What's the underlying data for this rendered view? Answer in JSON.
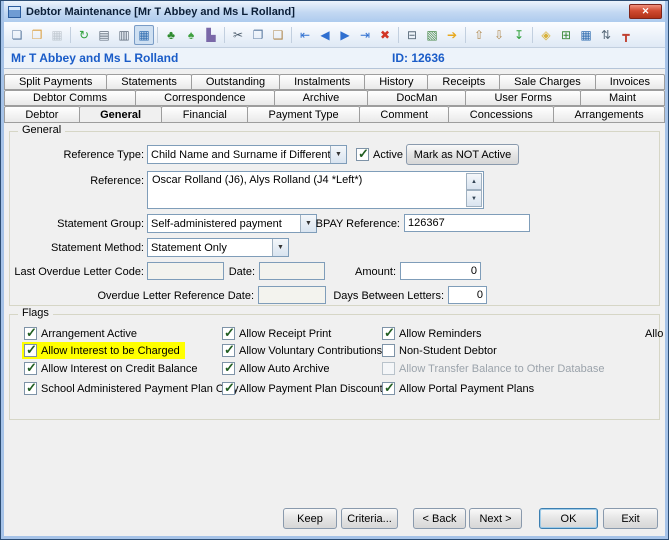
{
  "window": {
    "title": "Debtor Maintenance  [Mr T Abbey and Ms L Rolland]"
  },
  "toolbar": {
    "icons": [
      {
        "name": "new-document",
        "glyph": "❏"
      },
      {
        "name": "open-folder",
        "glyph": "❒"
      },
      {
        "name": "save",
        "glyph": "▦"
      },
      {
        "name": "refresh",
        "glyph": "↻"
      },
      {
        "name": "print",
        "glyph": "▤"
      },
      {
        "name": "print-preview",
        "glyph": "▥"
      },
      {
        "name": "data-grid",
        "glyph": "▦"
      },
      {
        "name": "tree-view",
        "glyph": "♣"
      },
      {
        "name": "palm-tree",
        "glyph": "♠"
      },
      {
        "name": "chart",
        "glyph": "▙"
      },
      {
        "name": "cut",
        "glyph": "✂"
      },
      {
        "name": "copy",
        "glyph": "❐"
      },
      {
        "name": "paste",
        "glyph": "❑"
      },
      {
        "name": "nav-first",
        "glyph": "⇤"
      },
      {
        "name": "nav-prev",
        "glyph": "◀"
      },
      {
        "name": "nav-next",
        "glyph": "▶"
      },
      {
        "name": "nav-last",
        "glyph": "⇥"
      },
      {
        "name": "delete",
        "glyph": "✖"
      },
      {
        "name": "remove-item",
        "glyph": "⊟"
      },
      {
        "name": "ledger",
        "glyph": "▧"
      },
      {
        "name": "forward",
        "glyph": "➔"
      },
      {
        "name": "export",
        "glyph": "⇧"
      },
      {
        "name": "import",
        "glyph": "⇩"
      },
      {
        "name": "download",
        "glyph": "↧"
      },
      {
        "name": "tag",
        "glyph": "◈"
      },
      {
        "name": "target",
        "glyph": "⊞"
      },
      {
        "name": "window-grid",
        "glyph": "▦"
      },
      {
        "name": "sort",
        "glyph": "⇅"
      },
      {
        "name": "pin",
        "glyph": "┳"
      }
    ]
  },
  "header": {
    "debtor_name": "Mr T Abbey and Ms L Rolland",
    "debtor_id": "ID: 12636"
  },
  "tabs": {
    "row1": [
      "Split Payments",
      "Statements",
      "Outstanding",
      "Instalments",
      "History",
      "Receipts",
      "Sale Charges",
      "Invoices"
    ],
    "row2": [
      "Debtor Comms",
      "Correspondence",
      "Archive",
      "DocMan",
      "User Forms",
      "Maint"
    ],
    "row3": [
      "Debtor",
      "General",
      "Financial",
      "Payment Type",
      "Comment",
      "Concessions",
      "Arrangements"
    ],
    "active": "General"
  },
  "general": {
    "group_label": "General",
    "reference_type_label": "Reference Type:",
    "reference_type_value": "Child Name and Surname if Different",
    "active_label": "Active",
    "mark_not_active_label": "Mark as NOT Active",
    "reference_label": "Reference:",
    "reference_value": "Oscar Rolland (J6), Alys Rolland (J4 *Left*)",
    "statement_group_label": "Statement Group:",
    "statement_group_value": "Self-administered payment",
    "bpay_label": "BPAY Reference:",
    "bpay_value": "126367",
    "statement_method_label": "Statement Method:",
    "statement_method_value": "Statement Only",
    "last_overdue_code_label": "Last Overdue Letter Code:",
    "date_label": "Date:",
    "amount_label": "Amount:",
    "amount_value": "0",
    "overdue_ref_date_label": "Overdue Letter Reference Date:",
    "days_between_label": "Days Between Letters:",
    "days_between_value": "0"
  },
  "flags": {
    "group_label": "Flags",
    "col1": [
      {
        "label": "Arrangement Active",
        "checked": true
      },
      {
        "label": "Allow Interest to be Charged",
        "checked": true,
        "highlighted": true
      },
      {
        "label": "Allow Interest on Credit Balance",
        "checked": true
      },
      {
        "label": "School Administered Payment Plan Only",
        "checked": true
      }
    ],
    "col2": [
      {
        "label": "Allow Receipt Print",
        "checked": true
      },
      {
        "label": "Allow Voluntary Contributions",
        "checked": true
      },
      {
        "label": "Allow Auto Archive",
        "checked": true
      },
      {
        "label": "Allow Payment Plan Discount",
        "checked": true
      }
    ],
    "col3": [
      {
        "label": "Allow Reminders",
        "checked": true
      },
      {
        "label": "Non-Student Debtor",
        "checked": false
      },
      {
        "label": "Allow Transfer Balance to Other Database",
        "checked": false,
        "disabled": true
      },
      {
        "label": "Allow Portal Payment Plans",
        "checked": true
      }
    ],
    "overflow_label": "Allo"
  },
  "footer": {
    "keep": "Keep",
    "criteria": "Criteria...",
    "back": "< Back",
    "next": "Next >",
    "ok": "OK",
    "exit": "Exit"
  }
}
